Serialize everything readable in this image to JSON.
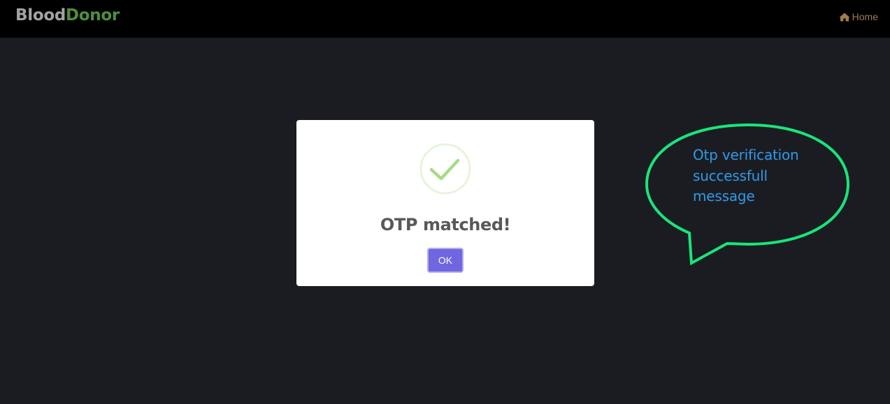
{
  "navbar": {
    "brand_part1": "Blood",
    "brand_part2": "Donor",
    "home_label": "Home",
    "home_icon": "home-icon"
  },
  "modal": {
    "icon": "success-check-icon",
    "title": "OTP matched!",
    "ok_label": "OK"
  },
  "annotation": {
    "line1": "Otp verification",
    "line2": "successfull",
    "line3": "message"
  },
  "colors": {
    "background": "#1b1c22",
    "navbar": "#000000",
    "brand_gray": "#a3a3a3",
    "brand_green": "#4f8e3e",
    "home_link": "#a07c4e",
    "check_green": "#a5dc86",
    "ok_button": "#7066e0",
    "callout_outline": "#19e57a",
    "callout_text": "#2f9be8"
  }
}
